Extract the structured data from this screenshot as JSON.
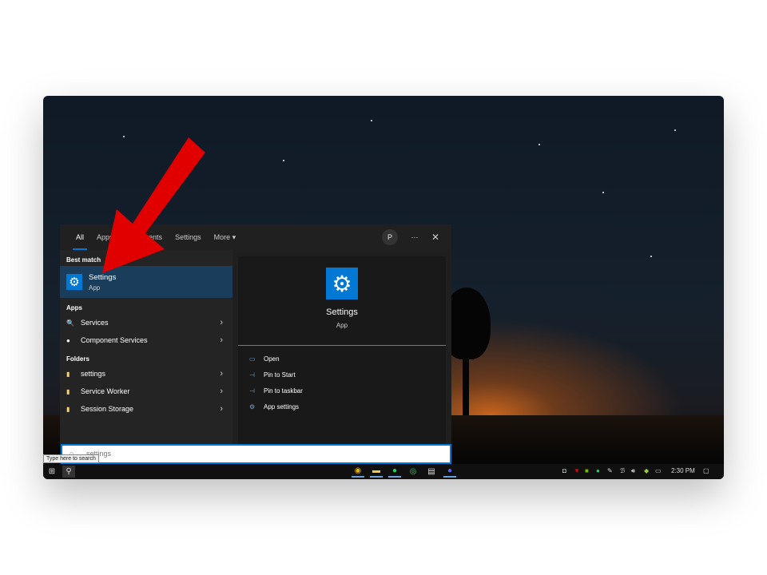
{
  "tabs": [
    "All",
    "Apps",
    "Documents",
    "Settings",
    "More ▾"
  ],
  "avatar": "P",
  "more_icon": "⋯",
  "close_icon": "✕",
  "best_match": {
    "heading": "Best match",
    "title": "Settings",
    "subtitle": "App"
  },
  "apps": {
    "heading": "Apps",
    "items": [
      "Services",
      "Component Services"
    ]
  },
  "folders": {
    "heading": "Folders",
    "items": [
      "settings",
      "Service Worker",
      "Session Storage"
    ]
  },
  "preview": {
    "title": "Settings",
    "subtitle": "App",
    "actions": [
      "Open",
      "Pin to Start",
      "Pin to taskbar",
      "App settings"
    ]
  },
  "search": {
    "value": "settings"
  },
  "tooltip": "Type here to search",
  "clock": "2:30 PM",
  "colors": {
    "accent": "#0078d4",
    "arrow": "#e00000"
  }
}
